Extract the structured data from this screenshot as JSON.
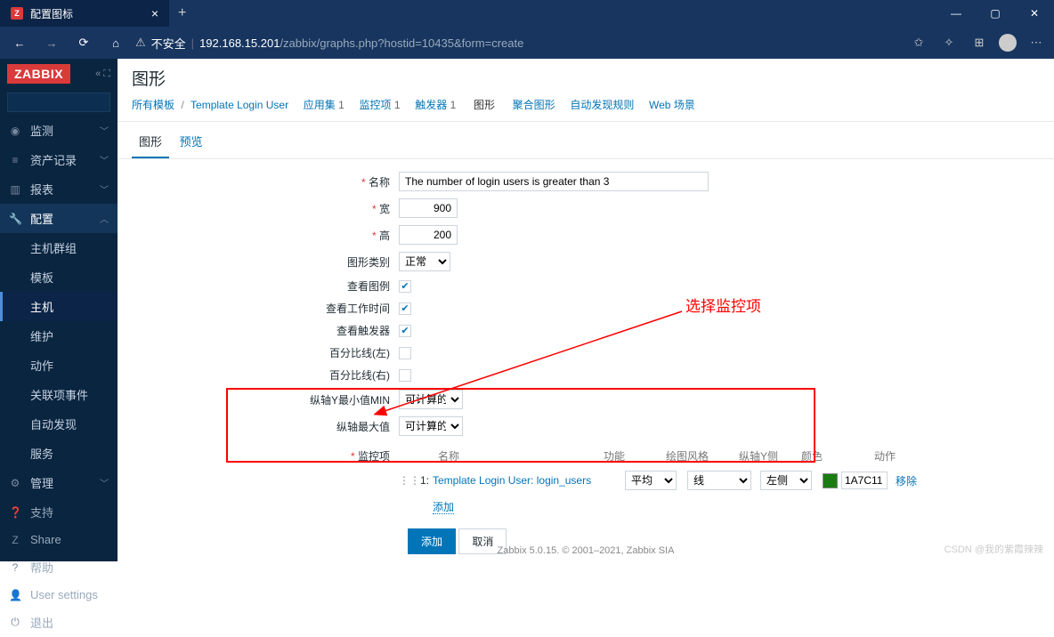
{
  "browser": {
    "tab_title": "配置图标",
    "warn_label": "不安全",
    "url_host": "192.168.15.201",
    "url_path": "/zabbix/graphs.php?hostid=10435&form=create"
  },
  "sidebar": {
    "logo": "ZABBIX",
    "nav": {
      "monitoring": "监测",
      "inventory": "资产记录",
      "reports": "报表",
      "config": "配置",
      "admin": "管理"
    },
    "config_items": {
      "hostgroups": "主机群组",
      "templates": "模板",
      "hosts": "主机",
      "maintenance": "维护",
      "actions": "动作",
      "correlation": "关联项事件",
      "discovery": "自动发现",
      "services": "服务"
    },
    "bottom": {
      "support": "支持",
      "share": "Share",
      "help": "帮助",
      "user": "User settings",
      "logout": "退出"
    }
  },
  "page": {
    "title": "图形",
    "breadcrumb": {
      "all_templates": "所有模板",
      "template_name": "Template Login User",
      "apps": "应用集",
      "apps_n": "1",
      "items": "监控项",
      "items_n": "1",
      "triggers": "触发器",
      "triggers_n": "1",
      "graphs": "图形",
      "aggregate": "聚合图形",
      "discovery": "自动发现规则",
      "web": "Web 场景"
    },
    "tabs": {
      "graph": "图形",
      "preview": "预览"
    }
  },
  "form": {
    "labels": {
      "name": "名称",
      "width": "宽",
      "height": "高",
      "type": "图形类别",
      "legend": "查看图例",
      "worktime": "查看工作时间",
      "triggers": "查看触发器",
      "pleft": "百分比线(左)",
      "pright": "百分比线(右)",
      "ymin": "纵轴Y最小值MIN",
      "ymax": "纵轴最大值",
      "items": "监控项"
    },
    "values": {
      "name": "The number of login users is greater than 3",
      "width": "900",
      "height": "200",
      "type": "正常",
      "ymin": "可计算的",
      "ymax": "可计算的"
    },
    "item_table": {
      "head": {
        "name": "名称",
        "func": "功能",
        "style": "绘图风格",
        "axis": "纵轴Y侧",
        "color": "颜色",
        "act": "动作"
      },
      "row": {
        "idx": "1:",
        "link": "Template Login User: login_users",
        "func": "平均",
        "style": "线",
        "axis": "左侧",
        "color": "1A7C11",
        "del": "移除"
      },
      "add": "添加"
    },
    "buttons": {
      "add": "添加",
      "cancel": "取消"
    }
  },
  "annotation": {
    "label": "选择监控项"
  },
  "footer": "Zabbix 5.0.15. © 2001–2021, Zabbix SIA",
  "watermark": "CSDN @我的紫霞辣辣"
}
